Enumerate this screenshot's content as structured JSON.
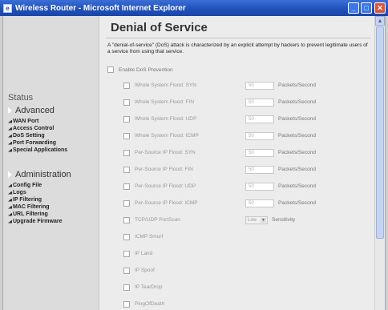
{
  "window": {
    "title": "Wireless Router - Microsoft Internet Explorer",
    "min_label": "_",
    "max_label": "□",
    "close_label": "✕"
  },
  "sidebar": {
    "status_label": "Status",
    "groups": [
      {
        "title": "Advanced",
        "items": [
          "WAN Port",
          "Access Control",
          "DoS Setting",
          "Port Forwarding",
          "Special Applications"
        ]
      },
      {
        "title": "Administration",
        "items": [
          "Config File",
          "Logs",
          "IP Filtering",
          "MAC Filtering",
          "URL Filtering",
          "Upgrade Firmware"
        ]
      }
    ]
  },
  "main": {
    "title": "Denial of Service",
    "description": "A \"denial-of-service\" (DoS) attack is characterized by an explicit attempt by hackers to prevent legitimate users of a service from using that service.",
    "enable_label": "Enable DoS Prevention",
    "options": [
      {
        "label": "Whole System Flood: SYN",
        "value": "50",
        "unit": "Packets/Second"
      },
      {
        "label": "Whole System Flood: FIN",
        "value": "50",
        "unit": "Packets/Second"
      },
      {
        "label": "Whole System Flood: UDP",
        "value": "50",
        "unit": "Packets/Second"
      },
      {
        "label": "Whole System Flood: ICMP",
        "value": "50",
        "unit": "Packets/Second"
      },
      {
        "label": "Per-Source IP Flood: SYN",
        "value": "50",
        "unit": "Packets/Second"
      },
      {
        "label": "Per-Source IP Flood: FIN",
        "value": "50",
        "unit": "Packets/Second"
      },
      {
        "label": "Per-Source IP Flood: UDP",
        "value": "50",
        "unit": "Packets/Second"
      },
      {
        "label": "Per-Source IP Flood: ICMP",
        "value": "50",
        "unit": "Packets/Second"
      },
      {
        "label": "TCP/UDP PortScan",
        "select": "Low",
        "unit": "Sensitivity"
      },
      {
        "label": "ICMP Smurf"
      },
      {
        "label": "IP Land"
      },
      {
        "label": "IP Spoof"
      },
      {
        "label": "IP TearDrop"
      },
      {
        "label": "PingOfDeath"
      }
    ]
  },
  "colors": {
    "titlebar": "#1f4fb8",
    "sidebar_bg": "#dcdcdc",
    "content_bg": "#ececec"
  }
}
